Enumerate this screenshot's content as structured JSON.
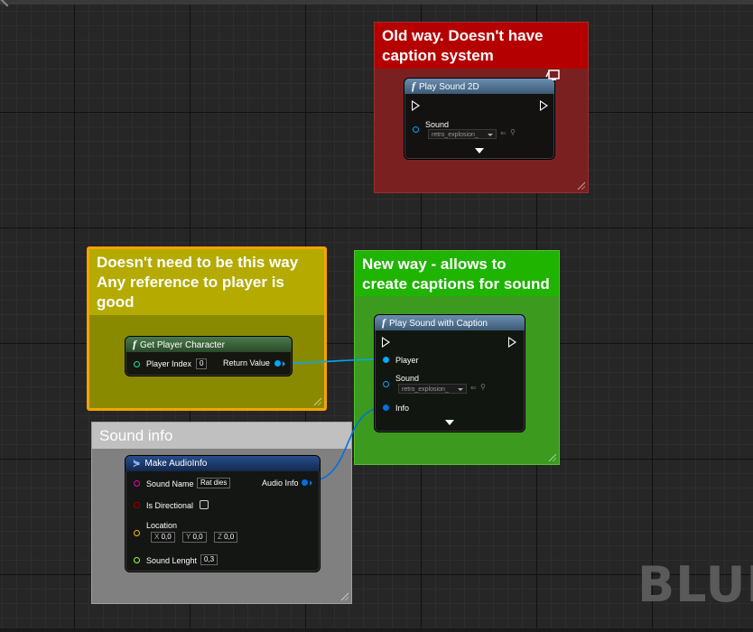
{
  "comments": {
    "old_way": "Old way. Doesn't have caption system",
    "player_ref": "Doesn't need to be this way Any reference to player is good",
    "new_way": "New way - allows to create captions for sound",
    "sound_info": "Sound info"
  },
  "nodes": {
    "play_sound_2d": {
      "title": "Play Sound 2D",
      "sound_label": "Sound",
      "sound_value": "retro_explosion_"
    },
    "get_player_character": {
      "title": "Get Player Character",
      "player_index_label": "Player Index",
      "player_index_value": "0",
      "return_label": "Return Value"
    },
    "play_sound_with_caption": {
      "title": "Play Sound with Caption",
      "player_label": "Player",
      "sound_label": "Sound",
      "sound_value": "retro_explosion_",
      "info_label": "Info"
    },
    "make_audio_info": {
      "title": "Make AudioInfo",
      "sound_name_label": "Sound Name",
      "sound_name_value": "Rat dies",
      "audio_info_label": "Audio Info",
      "is_directional_label": "Is Directional",
      "location_label": "Location",
      "x_label": "X",
      "x_value": "0,0",
      "y_label": "Y",
      "y_value": "0,0",
      "z_label": "Z",
      "z_value": "0,0",
      "sound_length_label": "Sound Lenght",
      "sound_length_value": "0,3"
    }
  },
  "watermark": "BLUE",
  "icons": [
    "function-icon",
    "make-struct-icon",
    "browse-arrow-icon",
    "search-icon",
    "server-only-icon",
    "exec-pin-icon",
    "expand-chevron-icon"
  ],
  "colors": {
    "object_pin": "#00a8f4",
    "struct_pin": "#0070e0",
    "string_pin": "#f000a0",
    "bool_pin": "#950000",
    "vector_pin": "#f5c000",
    "float_pin": "#9cff3c",
    "int_pin": "#1fe0a0",
    "comment_red": "#b50000",
    "comment_yellow": "#b4aa00",
    "comment_green": "#1eb400",
    "comment_gray": "#c0c0c0"
  }
}
